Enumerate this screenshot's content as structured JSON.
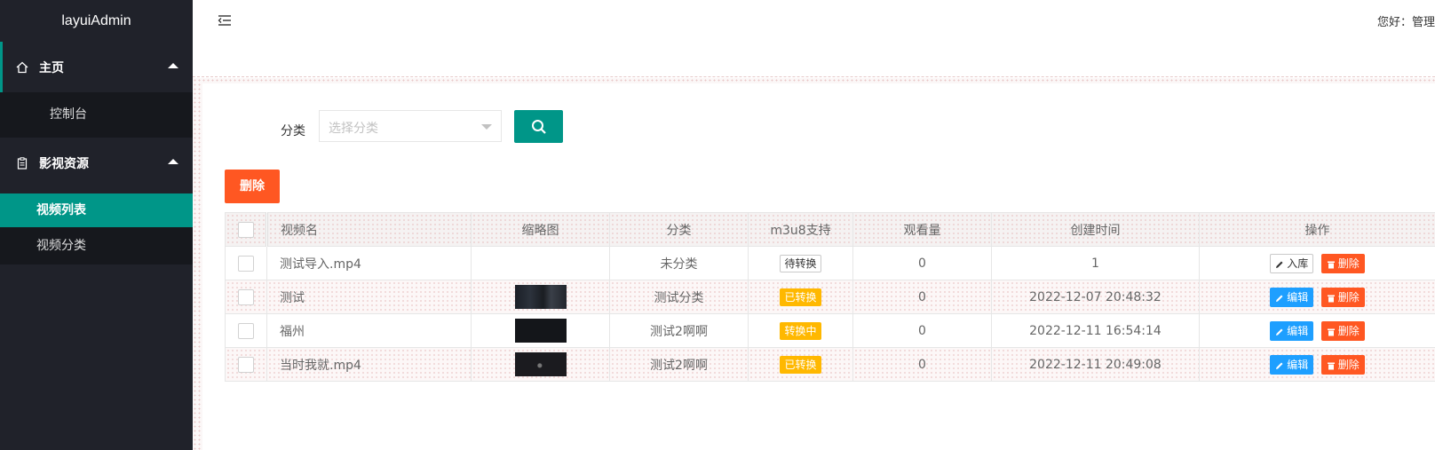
{
  "app": {
    "title": "layuiAdmin"
  },
  "sidebar": {
    "home": {
      "label": "主页"
    },
    "home_children": [
      "控制台"
    ],
    "media": {
      "label": "影视资源"
    },
    "media_children": [
      "视频列表",
      "视频分类"
    ],
    "active_item": "视频列表"
  },
  "header": {
    "greeting": "您好：管理"
  },
  "filter": {
    "label": "分类",
    "select_placeholder": "选择分类"
  },
  "toolbar": {
    "delete_label": "删除"
  },
  "table": {
    "headers": [
      "视频名",
      "缩略图",
      "分类",
      "m3u8支持",
      "观看量",
      "创建时间",
      "操作"
    ],
    "rows": [
      {
        "name": "测试导入.mp4",
        "thumb": "none",
        "category": "未分类",
        "m3u8": "待转换",
        "m3u8_status": "pending",
        "views": "0",
        "created": "1",
        "actions": [
          "入库",
          "删除"
        ]
      },
      {
        "name": "测试",
        "thumb": "t1",
        "category": "测试分类",
        "m3u8": "已转换",
        "m3u8_status": "done",
        "views": "0",
        "created": "2022-12-07 20:48:32",
        "actions": [
          "编辑",
          "删除"
        ]
      },
      {
        "name": "福州",
        "thumb": "t2",
        "category": "测试2啊啊",
        "m3u8": "转换中",
        "m3u8_status": "done",
        "views": "0",
        "created": "2022-12-11 16:54:14",
        "actions": [
          "编辑",
          "删除"
        ]
      },
      {
        "name": "当时我就.mp4",
        "thumb": "t3",
        "category": "测试2啊啊",
        "m3u8": "已转换",
        "m3u8_status": "done",
        "views": "0",
        "created": "2022-12-11 20:49:08",
        "actions": [
          "编辑",
          "删除"
        ]
      }
    ]
  },
  "colors": {
    "primary": "#009688",
    "danger": "#ff5722",
    "warn": "#ffb800",
    "info": "#1e9fff",
    "sidebar_bg": "#20222a"
  },
  "icons": {
    "home": "home-icon",
    "media": "clipboard-icon",
    "menu": "menu-fold-icon",
    "search": "search-icon",
    "edit": "pencil-icon",
    "delete": "trash-icon"
  }
}
